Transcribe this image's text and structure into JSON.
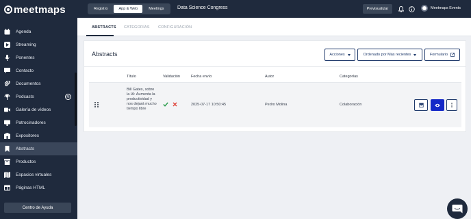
{
  "brand": {
    "logo_text": "meetmaps"
  },
  "sidebar": {
    "items": [
      {
        "label": "Agenda",
        "icon": "calendar-icon"
      },
      {
        "label": "Streaming",
        "icon": "play-icon"
      },
      {
        "label": "Ponentes",
        "icon": "microphone-icon"
      },
      {
        "label": "Contacto",
        "icon": "chat-icon"
      },
      {
        "label": "Documentos",
        "icon": "paperclip-icon"
      },
      {
        "label": "Podcasts",
        "icon": "podcast-icon",
        "badge": "M"
      },
      {
        "label": "Galería de vídeos",
        "icon": "video-icon"
      },
      {
        "label": "Patrocinadores",
        "icon": "sponsor-icon"
      },
      {
        "label": "Expositores",
        "icon": "exhibitor-icon"
      },
      {
        "label": "Abstracts",
        "icon": "bookmark-icon",
        "active": true
      },
      {
        "label": "Productos",
        "icon": "box-icon"
      },
      {
        "label": "Espacios virtuales",
        "icon": "map-icon"
      },
      {
        "label": "Páginas HTML",
        "icon": "page-icon"
      }
    ],
    "help_button": "Centro de Ayuda"
  },
  "topbar": {
    "segments": [
      {
        "label": "Registro",
        "active": false
      },
      {
        "label": "App & Web",
        "active": true
      },
      {
        "label": "Meetings",
        "active": false
      }
    ],
    "event_title": "Data Science Congress",
    "preview_button": "Previsualizar",
    "user_name": "Meetmaps Events"
  },
  "tabs": [
    {
      "label": "ABSTRACTS",
      "active": true
    },
    {
      "label": "CATEGORÍAS",
      "active": false
    },
    {
      "label": "CONFIGURACIÓN",
      "active": false
    }
  ],
  "card": {
    "title": "Abstracts",
    "actions_button": "Acciones",
    "sort_button": "Ordenado por Más recientes",
    "form_button": "Formulario"
  },
  "table": {
    "columns": [
      "Título",
      "Validación",
      "Fecha envío",
      "Autor",
      "Categorías"
    ],
    "rows": [
      {
        "title": "Bill Gates, sobre la IA: Aumenta la productividad y nos dejará mucho tiempo libre",
        "date": "2025-07-17 10:50:45",
        "author": "Pedro Molina",
        "category": "Colaboración"
      }
    ]
  },
  "colors": {
    "sidebar_bg": "#1f2a3d",
    "accent": "#1428c8",
    "approve": "#2e9e4f",
    "reject": "#e0443b"
  }
}
